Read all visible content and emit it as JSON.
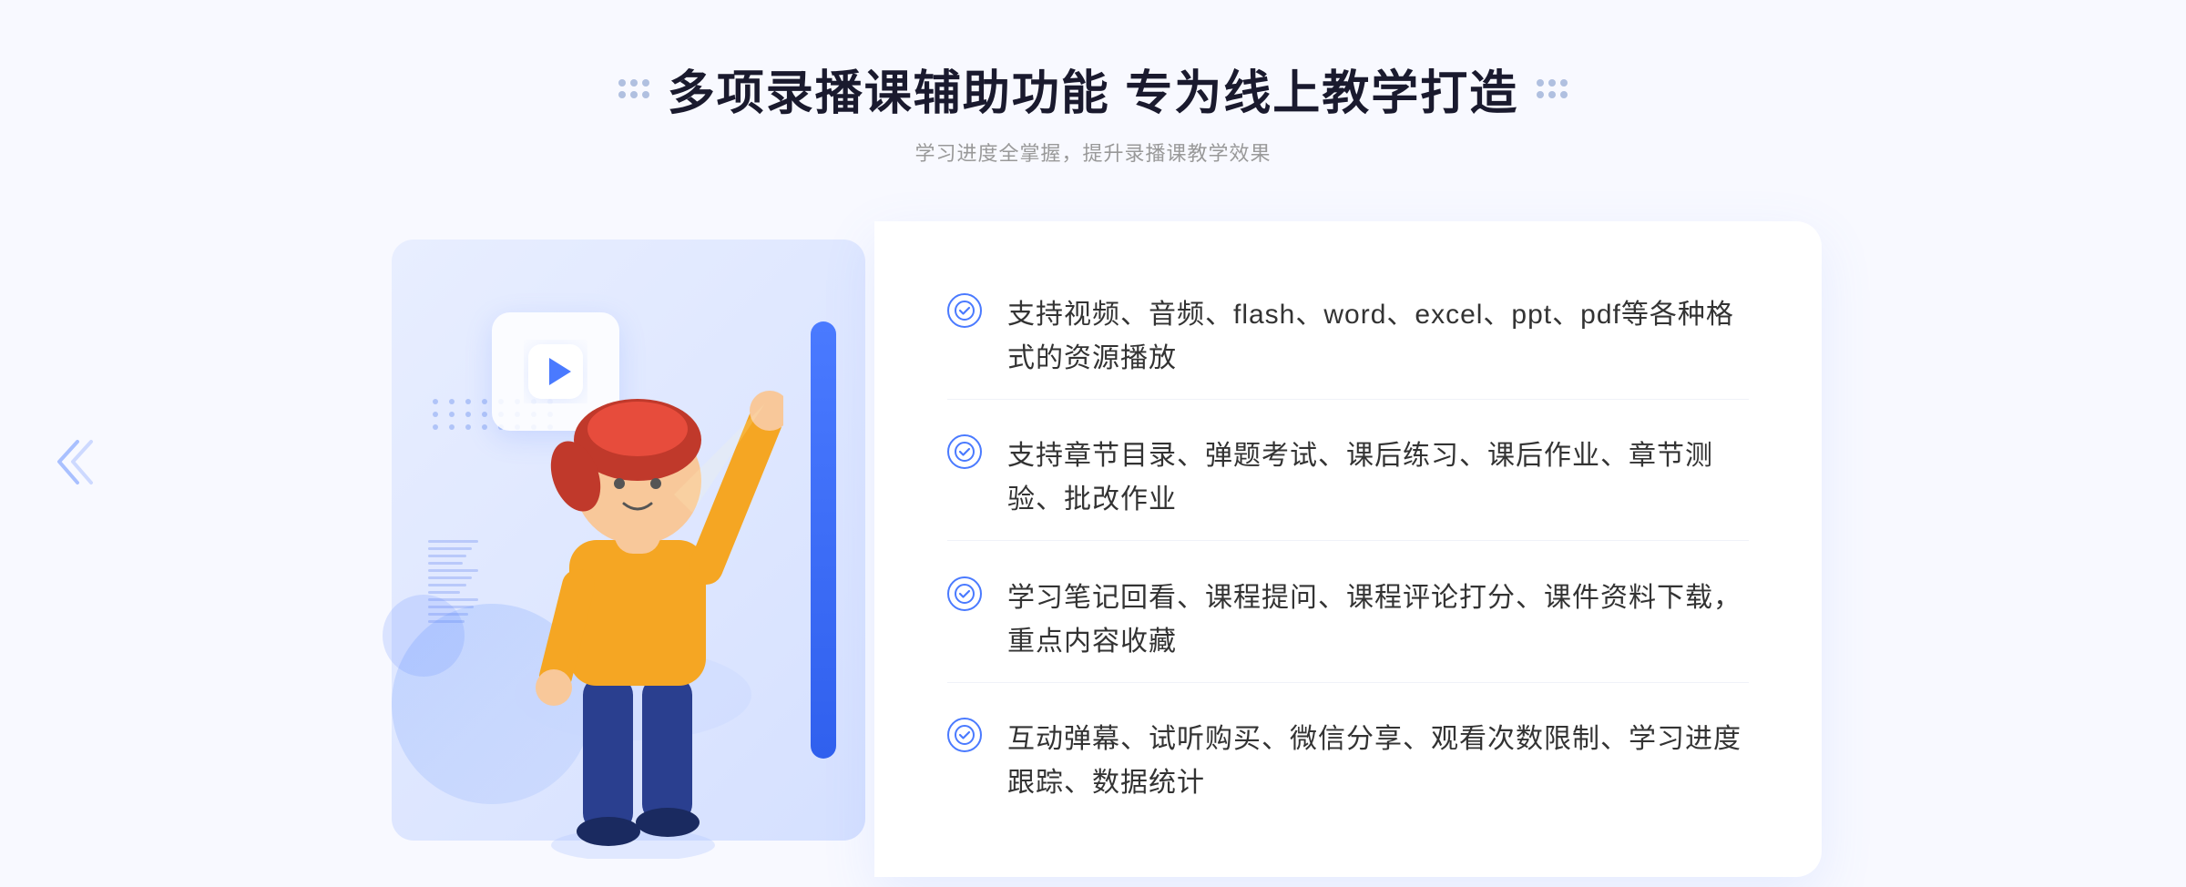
{
  "header": {
    "title": "多项录播课辅助功能 专为线上教学打造",
    "subtitle": "学习进度全掌握，提升录播课教学效果"
  },
  "features": [
    {
      "id": 1,
      "text": "支持视频、音频、flash、word、excel、ppt、pdf等各种格式的资源播放"
    },
    {
      "id": 2,
      "text": "支持章节目录、弹题考试、课后练习、课后作业、章节测验、批改作业"
    },
    {
      "id": 3,
      "text": "学习笔记回看、课程提问、课程评论打分、课件资料下载，重点内容收藏"
    },
    {
      "id": 4,
      "text": "互动弹幕、试听购买、微信分享、观看次数限制、学习进度跟踪、数据统计"
    }
  ],
  "colors": {
    "primary": "#4a7aff",
    "title": "#1a1a2e",
    "subtitle": "#999999",
    "text": "#333333",
    "check": "#4a7aff"
  },
  "icons": {
    "check": "✓",
    "play": "▶",
    "chevron_left": "«"
  }
}
